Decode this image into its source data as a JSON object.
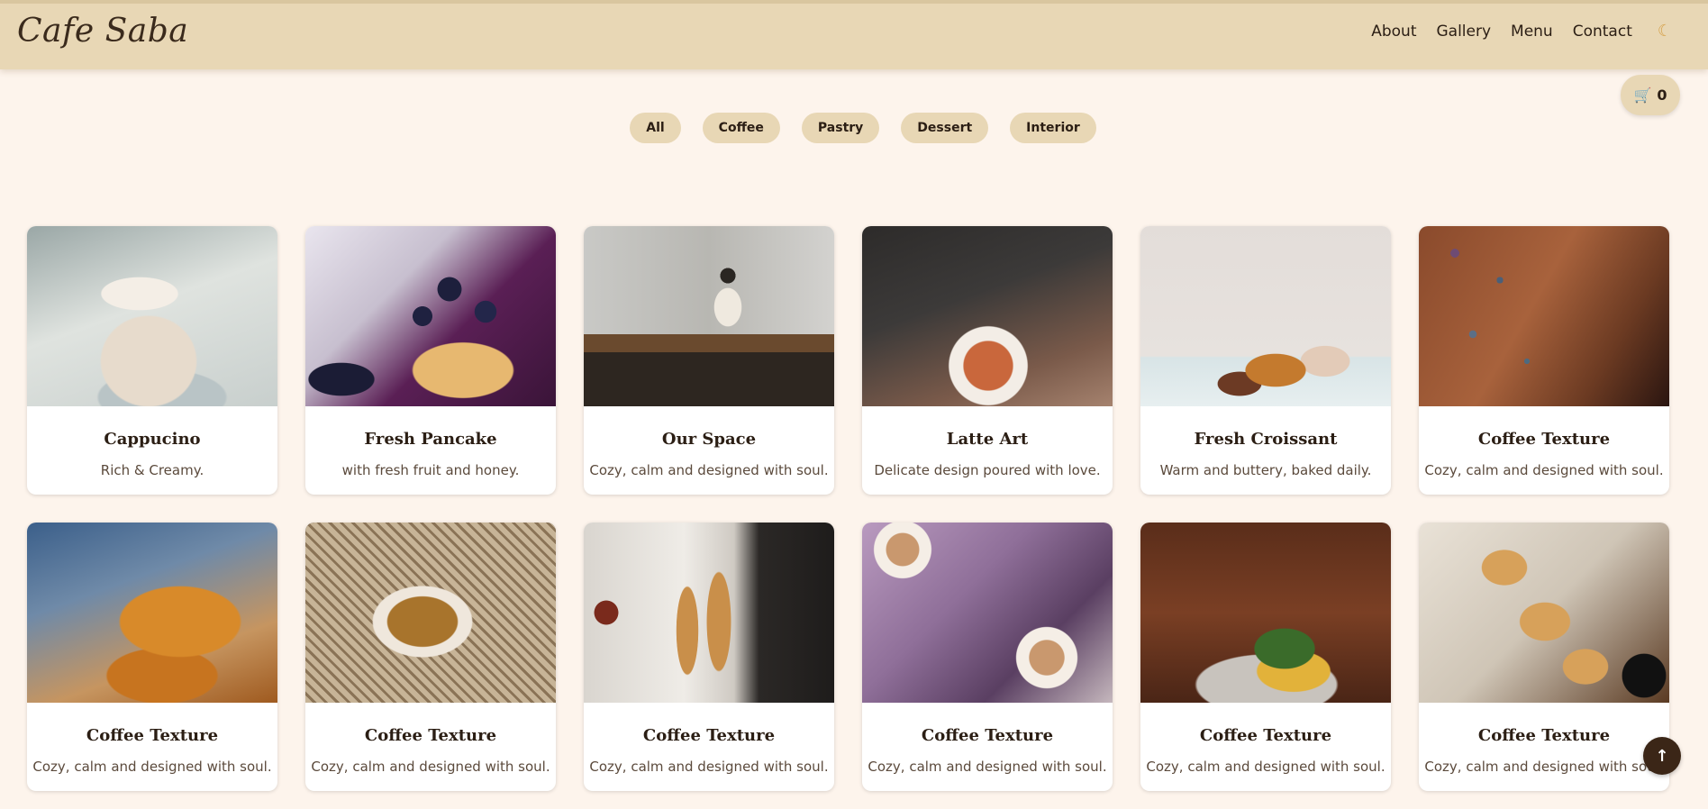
{
  "brand": {
    "logo": "Cafe Saba"
  },
  "nav": {
    "items": [
      "About",
      "Gallery",
      "Menu",
      "Contact"
    ],
    "theme_icon": "moon-icon"
  },
  "cart": {
    "icon": "cart-icon",
    "count": "0"
  },
  "filters": [
    "All",
    "Coffee",
    "Pastry",
    "Dessert",
    "Interior"
  ],
  "gallery": [
    {
      "title": "Cappucino",
      "desc": "Rich & Creamy."
    },
    {
      "title": "Fresh Pancake",
      "desc": "with fresh fruit and honey."
    },
    {
      "title": "Our Space",
      "desc": "Cozy, calm and designed with soul."
    },
    {
      "title": "Latte Art",
      "desc": "Delicate design poured with love."
    },
    {
      "title": "Fresh Croissant",
      "desc": "Warm and buttery, baked daily."
    },
    {
      "title": "Coffee Texture",
      "desc": "Cozy, calm and designed with soul."
    },
    {
      "title": "Coffee Texture",
      "desc": "Cozy, calm and designed with soul."
    },
    {
      "title": "Coffee Texture",
      "desc": "Cozy, calm and designed with soul."
    },
    {
      "title": "Coffee Texture",
      "desc": "Cozy, calm and designed with soul."
    },
    {
      "title": "Coffee Texture",
      "desc": "Cozy, calm and designed with soul."
    },
    {
      "title": "Coffee Texture",
      "desc": "Cozy, calm and designed with soul."
    },
    {
      "title": "Coffee Texture",
      "desc": "Cozy, calm and designed with soul."
    }
  ],
  "back_to_top": {
    "icon": "arrow-up-icon",
    "label": "↑"
  },
  "colors": {
    "header": "#e8d7b5",
    "background": "#fdf4ec",
    "accent": "#3b2617"
  }
}
